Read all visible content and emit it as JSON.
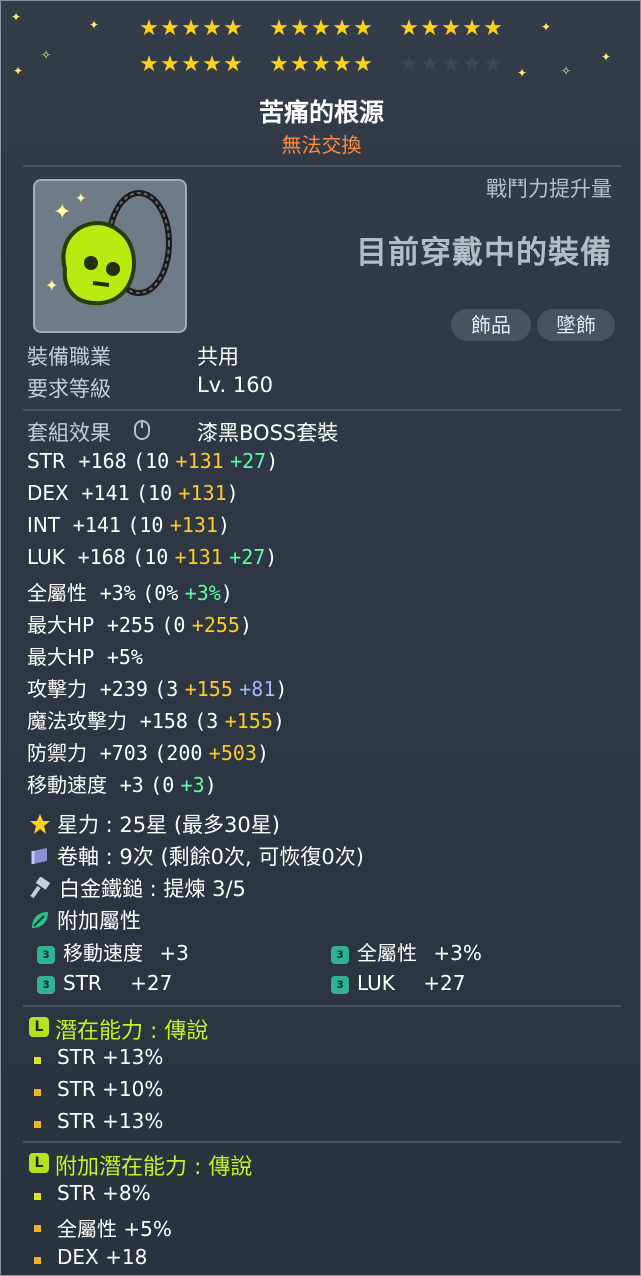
{
  "stars": {
    "filled": 25,
    "total": 30,
    "filled_color": "#ffd21a",
    "empty_color": "#3f4752"
  },
  "item": {
    "name": "苦痛的根源",
    "trade_status": "無法交換"
  },
  "header": {
    "combat_power_label": "戰鬥力提升量",
    "equipped_label": "目前穿戴中的裝備",
    "tags": [
      "飾品",
      "墜飾"
    ]
  },
  "requirements": {
    "job_label": "裝備職業",
    "job_value": "共用",
    "level_label": "要求等級",
    "level_value": "Lv. 160"
  },
  "set_effect": {
    "label": "套組效果",
    "value": "漆黑BOSS套裝"
  },
  "stats": [
    {
      "name": "STR",
      "total": "+168",
      "open": "(10",
      "b1": "+131",
      "b2": "+27",
      "b2_color": "green",
      "close": ")"
    },
    {
      "name": "DEX",
      "total": "+141",
      "open": "(10",
      "b1": "+131",
      "b2": "",
      "b2_color": "green",
      "close": ")"
    },
    {
      "name": "INT",
      "total": "+141",
      "open": "(10",
      "b1": "+131",
      "b2": "",
      "b2_color": "green",
      "close": ")"
    },
    {
      "name": "LUK",
      "total": "+168",
      "open": "(10",
      "b1": "+131",
      "b2": "+27",
      "b2_color": "green",
      "close": ")"
    },
    {
      "name": "全屬性",
      "total": "+3%",
      "open": "(0%",
      "b1": "",
      "b2": "+3%",
      "b2_color": "green",
      "close": ")"
    },
    {
      "name": "最大HP",
      "total": "+255",
      "open": "(0",
      "b1": "+255",
      "b2": "",
      "b2_color": "green",
      "close": ")"
    },
    {
      "name": "最大HP",
      "total": "+5%",
      "open": "",
      "b1": "",
      "b2": "",
      "b2_color": "green",
      "close": ""
    },
    {
      "name": "攻擊力",
      "total": "+239",
      "open": "(3",
      "b1": "+155",
      "b2": "+81",
      "b2_color": "blue",
      "close": ")"
    },
    {
      "name": "魔法攻擊力",
      "total": "+158",
      "open": "(3",
      "b1": "+155",
      "b2": "",
      "b2_color": "green",
      "close": ")"
    },
    {
      "name": "防禦力",
      "total": "+703",
      "open": "(200",
      "b1": "+503",
      "b2": "",
      "b2_color": "green",
      "close": ")"
    },
    {
      "name": "移動速度",
      "total": "+3",
      "open": "(0",
      "b1": "",
      "b2": "+3",
      "b2_color": "green",
      "close": ")"
    }
  ],
  "info": {
    "starforce": "星力 : 25星 (最多30星)",
    "scroll": "卷軸 : 9次 (剩餘0次, 可恢復0次)",
    "hammer": "白金鐵鎚 : 提煉 3/5",
    "flame_label": "附加屬性"
  },
  "flame": [
    {
      "name": "移動速度",
      "value": "+3"
    },
    {
      "name": "全屬性",
      "value": "+3%"
    },
    {
      "name": "STR",
      "value": "+27"
    },
    {
      "name": "LUK",
      "value": "+27"
    }
  ],
  "potential": {
    "title": "潛在能力 : 傳說",
    "lines": [
      "STR +13%",
      "STR +10%",
      "STR +13%"
    ],
    "dot_colors": [
      "#d8e81c",
      "#f0b41c",
      "#f0b41c"
    ]
  },
  "additional_potential": {
    "title": "附加潛在能力 : 傳說",
    "lines": [
      "STR +8%",
      "全屬性 +5%",
      "DEX +18"
    ],
    "dot_colors": [
      "#d8e81c",
      "#f0b41c",
      "#f0b41c"
    ]
  }
}
